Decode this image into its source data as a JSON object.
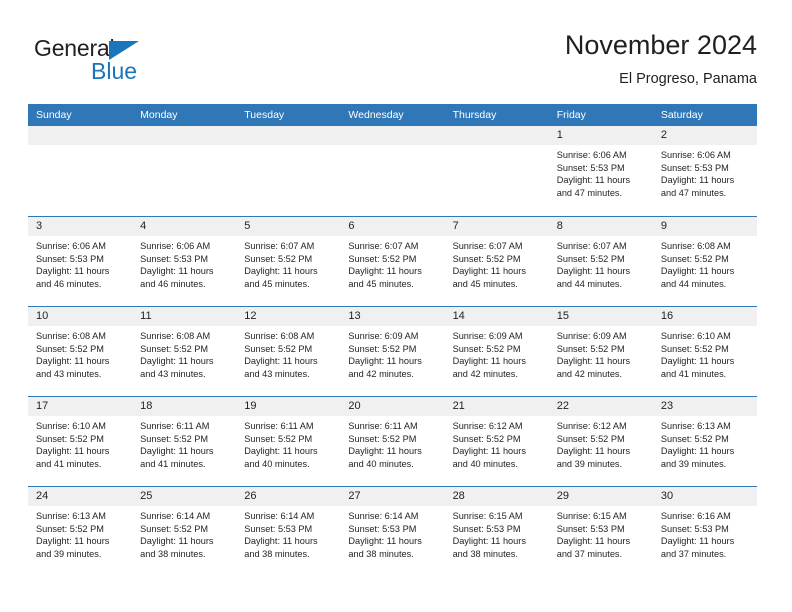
{
  "brand": {
    "name_top": "General",
    "name_bottom": "Blue",
    "triangle_color": "#1b75bb",
    "text_color": "#231f20"
  },
  "header": {
    "title": "November 2024",
    "subtitle": "El Progreso, Panama"
  },
  "theme": {
    "header_blue": "#3077b8",
    "day_strip_gray": "#f0f0f0",
    "text": "#231f20",
    "background": "#ffffff"
  },
  "weekdays": [
    "Sunday",
    "Monday",
    "Tuesday",
    "Wednesday",
    "Thursday",
    "Friday",
    "Saturday"
  ],
  "weeks": [
    [
      {
        "day": "",
        "sunrise": "",
        "sunset": "",
        "daylight1": "",
        "daylight2": "",
        "empty": true
      },
      {
        "day": "",
        "sunrise": "",
        "sunset": "",
        "daylight1": "",
        "daylight2": "",
        "empty": true
      },
      {
        "day": "",
        "sunrise": "",
        "sunset": "",
        "daylight1": "",
        "daylight2": "",
        "empty": true
      },
      {
        "day": "",
        "sunrise": "",
        "sunset": "",
        "daylight1": "",
        "daylight2": "",
        "empty": true
      },
      {
        "day": "",
        "sunrise": "",
        "sunset": "",
        "daylight1": "",
        "daylight2": "",
        "empty": true
      },
      {
        "day": "1",
        "sunrise": "Sunrise: 6:06 AM",
        "sunset": "Sunset: 5:53 PM",
        "daylight1": "Daylight: 11 hours",
        "daylight2": "and 47 minutes."
      },
      {
        "day": "2",
        "sunrise": "Sunrise: 6:06 AM",
        "sunset": "Sunset: 5:53 PM",
        "daylight1": "Daylight: 11 hours",
        "daylight2": "and 47 minutes."
      }
    ],
    [
      {
        "day": "3",
        "sunrise": "Sunrise: 6:06 AM",
        "sunset": "Sunset: 5:53 PM",
        "daylight1": "Daylight: 11 hours",
        "daylight2": "and 46 minutes."
      },
      {
        "day": "4",
        "sunrise": "Sunrise: 6:06 AM",
        "sunset": "Sunset: 5:53 PM",
        "daylight1": "Daylight: 11 hours",
        "daylight2": "and 46 minutes."
      },
      {
        "day": "5",
        "sunrise": "Sunrise: 6:07 AM",
        "sunset": "Sunset: 5:52 PM",
        "daylight1": "Daylight: 11 hours",
        "daylight2": "and 45 minutes."
      },
      {
        "day": "6",
        "sunrise": "Sunrise: 6:07 AM",
        "sunset": "Sunset: 5:52 PM",
        "daylight1": "Daylight: 11 hours",
        "daylight2": "and 45 minutes."
      },
      {
        "day": "7",
        "sunrise": "Sunrise: 6:07 AM",
        "sunset": "Sunset: 5:52 PM",
        "daylight1": "Daylight: 11 hours",
        "daylight2": "and 45 minutes."
      },
      {
        "day": "8",
        "sunrise": "Sunrise: 6:07 AM",
        "sunset": "Sunset: 5:52 PM",
        "daylight1": "Daylight: 11 hours",
        "daylight2": "and 44 minutes."
      },
      {
        "day": "9",
        "sunrise": "Sunrise: 6:08 AM",
        "sunset": "Sunset: 5:52 PM",
        "daylight1": "Daylight: 11 hours",
        "daylight2": "and 44 minutes."
      }
    ],
    [
      {
        "day": "10",
        "sunrise": "Sunrise: 6:08 AM",
        "sunset": "Sunset: 5:52 PM",
        "daylight1": "Daylight: 11 hours",
        "daylight2": "and 43 minutes."
      },
      {
        "day": "11",
        "sunrise": "Sunrise: 6:08 AM",
        "sunset": "Sunset: 5:52 PM",
        "daylight1": "Daylight: 11 hours",
        "daylight2": "and 43 minutes."
      },
      {
        "day": "12",
        "sunrise": "Sunrise: 6:08 AM",
        "sunset": "Sunset: 5:52 PM",
        "daylight1": "Daylight: 11 hours",
        "daylight2": "and 43 minutes."
      },
      {
        "day": "13",
        "sunrise": "Sunrise: 6:09 AM",
        "sunset": "Sunset: 5:52 PM",
        "daylight1": "Daylight: 11 hours",
        "daylight2": "and 42 minutes."
      },
      {
        "day": "14",
        "sunrise": "Sunrise: 6:09 AM",
        "sunset": "Sunset: 5:52 PM",
        "daylight1": "Daylight: 11 hours",
        "daylight2": "and 42 minutes."
      },
      {
        "day": "15",
        "sunrise": "Sunrise: 6:09 AM",
        "sunset": "Sunset: 5:52 PM",
        "daylight1": "Daylight: 11 hours",
        "daylight2": "and 42 minutes."
      },
      {
        "day": "16",
        "sunrise": "Sunrise: 6:10 AM",
        "sunset": "Sunset: 5:52 PM",
        "daylight1": "Daylight: 11 hours",
        "daylight2": "and 41 minutes."
      }
    ],
    [
      {
        "day": "17",
        "sunrise": "Sunrise: 6:10 AM",
        "sunset": "Sunset: 5:52 PM",
        "daylight1": "Daylight: 11 hours",
        "daylight2": "and 41 minutes."
      },
      {
        "day": "18",
        "sunrise": "Sunrise: 6:11 AM",
        "sunset": "Sunset: 5:52 PM",
        "daylight1": "Daylight: 11 hours",
        "daylight2": "and 41 minutes."
      },
      {
        "day": "19",
        "sunrise": "Sunrise: 6:11 AM",
        "sunset": "Sunset: 5:52 PM",
        "daylight1": "Daylight: 11 hours",
        "daylight2": "and 40 minutes."
      },
      {
        "day": "20",
        "sunrise": "Sunrise: 6:11 AM",
        "sunset": "Sunset: 5:52 PM",
        "daylight1": "Daylight: 11 hours",
        "daylight2": "and 40 minutes."
      },
      {
        "day": "21",
        "sunrise": "Sunrise: 6:12 AM",
        "sunset": "Sunset: 5:52 PM",
        "daylight1": "Daylight: 11 hours",
        "daylight2": "and 40 minutes."
      },
      {
        "day": "22",
        "sunrise": "Sunrise: 6:12 AM",
        "sunset": "Sunset: 5:52 PM",
        "daylight1": "Daylight: 11 hours",
        "daylight2": "and 39 minutes."
      },
      {
        "day": "23",
        "sunrise": "Sunrise: 6:13 AM",
        "sunset": "Sunset: 5:52 PM",
        "daylight1": "Daylight: 11 hours",
        "daylight2": "and 39 minutes."
      }
    ],
    [
      {
        "day": "24",
        "sunrise": "Sunrise: 6:13 AM",
        "sunset": "Sunset: 5:52 PM",
        "daylight1": "Daylight: 11 hours",
        "daylight2": "and 39 minutes."
      },
      {
        "day": "25",
        "sunrise": "Sunrise: 6:14 AM",
        "sunset": "Sunset: 5:52 PM",
        "daylight1": "Daylight: 11 hours",
        "daylight2": "and 38 minutes."
      },
      {
        "day": "26",
        "sunrise": "Sunrise: 6:14 AM",
        "sunset": "Sunset: 5:53 PM",
        "daylight1": "Daylight: 11 hours",
        "daylight2": "and 38 minutes."
      },
      {
        "day": "27",
        "sunrise": "Sunrise: 6:14 AM",
        "sunset": "Sunset: 5:53 PM",
        "daylight1": "Daylight: 11 hours",
        "daylight2": "and 38 minutes."
      },
      {
        "day": "28",
        "sunrise": "Sunrise: 6:15 AM",
        "sunset": "Sunset: 5:53 PM",
        "daylight1": "Daylight: 11 hours",
        "daylight2": "and 38 minutes."
      },
      {
        "day": "29",
        "sunrise": "Sunrise: 6:15 AM",
        "sunset": "Sunset: 5:53 PM",
        "daylight1": "Daylight: 11 hours",
        "daylight2": "and 37 minutes."
      },
      {
        "day": "30",
        "sunrise": "Sunrise: 6:16 AM",
        "sunset": "Sunset: 5:53 PM",
        "daylight1": "Daylight: 11 hours",
        "daylight2": "and 37 minutes."
      }
    ]
  ]
}
